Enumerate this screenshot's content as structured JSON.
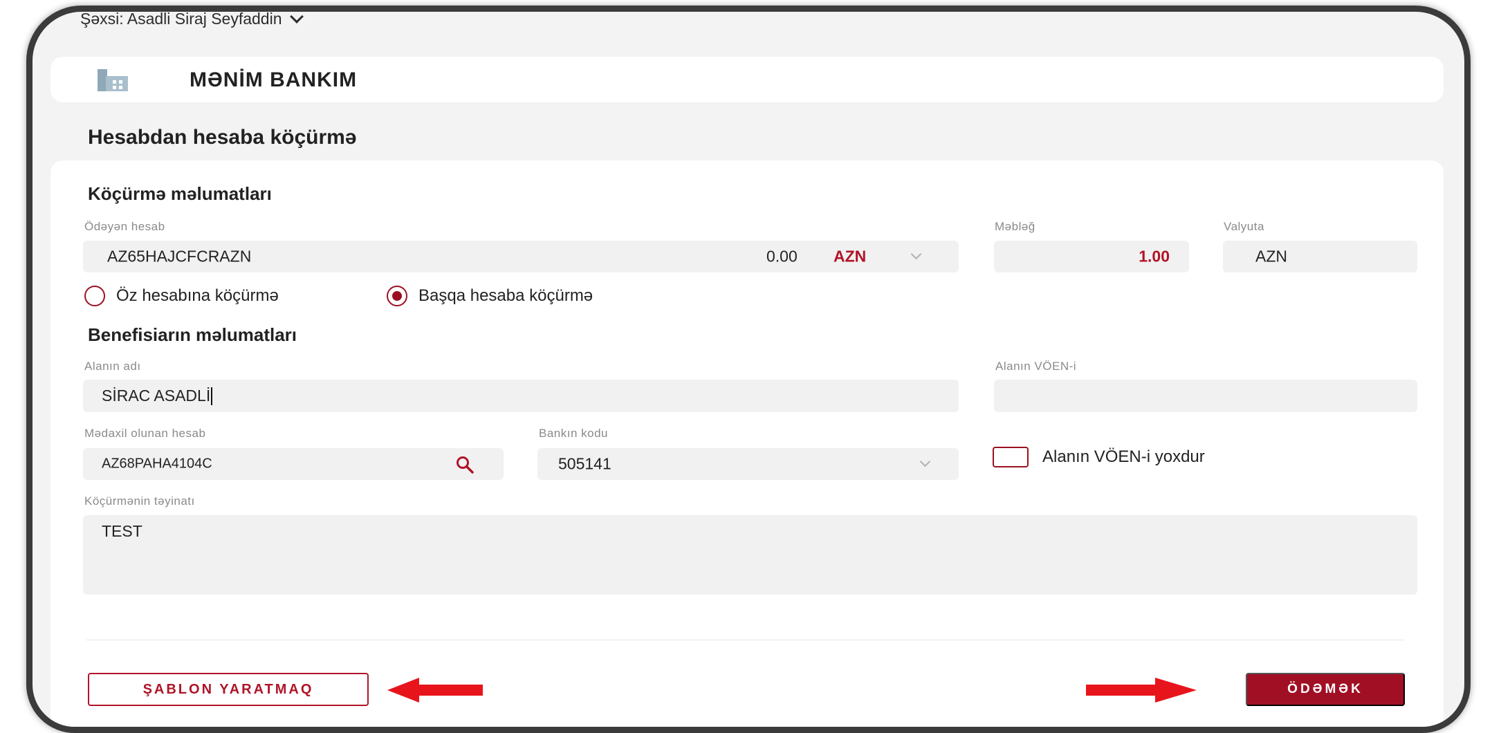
{
  "header": {
    "person_label": "Şəxsi: Asadli Siraj Seyfaddin",
    "bank_title": "MƏNİM BANKIM"
  },
  "page": {
    "title": "Hesabdan hesaba köçürmə"
  },
  "transfer": {
    "section_title": "Köçürmə məlumatları",
    "payer_label": "Ödəyən hesab",
    "payer_account": "AZ65HAJCFCRAZN",
    "payer_balance": "0.00",
    "payer_currency": "AZN",
    "amount_label": "Məbləğ",
    "amount_value": "1.00",
    "currency_label": "Valyuta",
    "currency_value": "AZN",
    "radio_own": "Öz hesabına köçürmə",
    "radio_other": "Başqa hesaba köçürmə",
    "selected_radio": "other"
  },
  "beneficiary": {
    "section_title": "Benefisiarın məlumatları",
    "name_label": "Alanın adı",
    "name_value": "SİRAC ASADLİ",
    "voen_label": "Alanın VÖEN-i",
    "voen_value": "",
    "account_label": "Mədaxil olunan hesab",
    "account_value": "AZ68PAHA4104C",
    "bank_code_label": "Bankın kodu",
    "bank_code_value": "505141",
    "no_voen_label": "Alanın VÖEN-i yoxdur",
    "purpose_label": "Köçürmənin təyinatı",
    "purpose_value": "TEST"
  },
  "actions": {
    "template_button": "ŞABLON YARATMAQ",
    "pay_button": "ÖDƏMƏK"
  },
  "colors": {
    "accent": "#a10f24",
    "arrow": "#e8141c",
    "field_bg": "#f1f1f1",
    "page_bg": "#f3f3f3"
  }
}
